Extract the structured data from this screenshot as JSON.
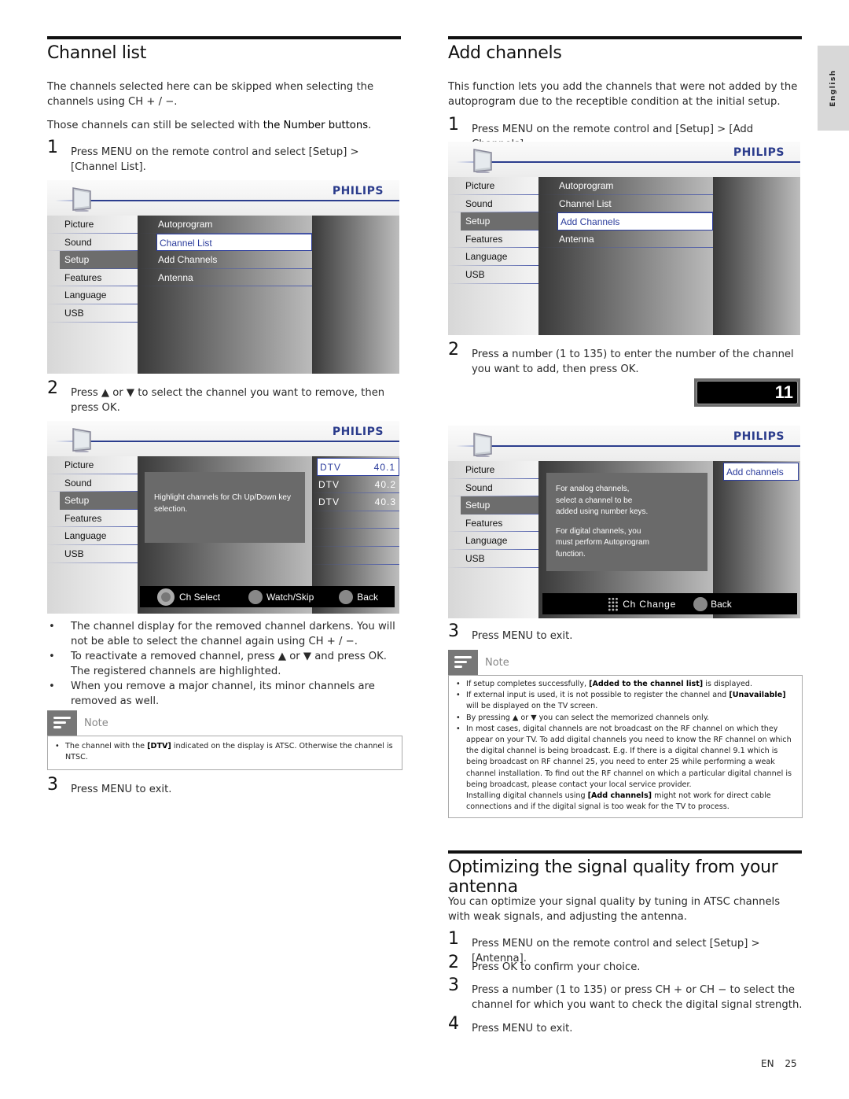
{
  "side_tab": "English",
  "footer": {
    "lang": "EN",
    "page": "25"
  },
  "channel_list": {
    "title": "Channel list",
    "intro1": "The channels selected here can be skipped when selecting the channels using CH + / −.",
    "intro2_pre": "Those channels can still be selected with ",
    "intro2_bold": "the Number buttons",
    "intro2_post": ".",
    "steps": [
      {
        "num": "1",
        "text": "Press MENU on the remote control and select [Setup] > [Channel List]."
      },
      {
        "num": "2",
        "text": "Press ▲ or ▼ to select the channel you want to remove, then press OK."
      },
      {
        "num": "3",
        "text": "Press MENU to exit."
      }
    ],
    "bullets": [
      "The channel display for the removed channel darkens. You will not be able to select the channel again using CH + / −.",
      "To reactivate a removed channel, press ▲ or ▼ and press OK. The registered channels are highlighted.",
      "When you remove a major channel, its minor channels are removed as well."
    ],
    "note": {
      "label": "Note",
      "items": [
        {
          "pre": "The channel with the ",
          "bold": "[DTV]",
          "post": " indicated on the display is ATSC. Otherwise the channel is NTSC."
        }
      ]
    }
  },
  "tv_menu": {
    "brand": "PHILIPS",
    "left_items": [
      "Picture",
      "Sound",
      "Setup",
      "Features",
      "Language",
      "USB"
    ],
    "selected_left": "Setup",
    "setup_items": [
      "Autoprogram",
      "Channel List",
      "Add Channels",
      "Antenna"
    ]
  },
  "tv_channel_list": {
    "info": "Highlight channels for Ch Up/Down key selection.",
    "channels": [
      {
        "type": "DTV",
        "num": "40.1",
        "selected": true
      },
      {
        "type": "DTV",
        "num": "40.2",
        "selected": false
      },
      {
        "type": "DTV",
        "num": "40.3",
        "selected": false
      }
    ],
    "buttons": {
      "ch_select": "Ch Select",
      "ok_small": "OK",
      "watch_skip": "Watch/Skip",
      "back_small": "BACK",
      "back": "Back"
    }
  },
  "add_channels": {
    "title": "Add channels",
    "intro": "This function lets you add the channels that were not added by the autoprogram due to the receptible condition at the initial setup.",
    "steps": [
      {
        "num": "1",
        "text": "Press MENU on the remote control and [Setup] > [Add Channels]."
      },
      {
        "num": "2",
        "text": "Press a number (1 to 135) to enter the number of the channel you want to add, then press OK."
      },
      {
        "num": "3",
        "text": "Press MENU to exit."
      }
    ],
    "channel_entry": "11",
    "tv_screen": {
      "option": "Add channels",
      "info_analog": "For analog channels, select a channel to be added using number keys.",
      "info_digital": "For digital channels, you must perform Autoprogram function.",
      "buttons": {
        "ch_change": "Ch Change",
        "back_small": "BACK",
        "back": "Back"
      }
    },
    "note": {
      "label": "Note",
      "items": [
        {
          "pre": "If setup completes successfully, ",
          "bold": "[Added to the channel list]",
          "post": " is displayed."
        },
        {
          "pre": "If external input is used, it is not possible to register the channel and ",
          "bold": "[Unavailable]",
          "post": " will be displayed on the TV screen."
        },
        {
          "pre": "By pressing ▲ or ▼ you can select the memorized channels only.",
          "bold": "",
          "post": ""
        },
        {
          "pre": "In most cases, digital channels are not broadcast on the RF channel on which they appear on your TV. To add digital channels you need to know the RF channel on which the digital channel is being broadcast. E.g. If there is a digital channel 9.1 which is being broadcast on RF channel 25, you need to enter 25 while performing a weak channel installation. To find out the RF channel on which a particular digital channel is being broadcast, please contact your local service provider.",
          "bold": "",
          "post": ""
        }
      ],
      "extra_pre": "Installing digital channels using ",
      "extra_bold": "[Add channels]",
      "extra_post": " might not work for direct cable connections and if the digital signal is too weak for the TV to process."
    }
  },
  "optimize": {
    "title": "Optimizing the signal quality from your antenna",
    "intro": "You can optimize your signal quality by tuning in ATSC channels with weak signals, and adjusting the antenna.",
    "steps": [
      {
        "num": "1",
        "text": "Press MENU on the remote control and select [Setup] > [Antenna]."
      },
      {
        "num": "2",
        "text": "Press OK to confirm your choice."
      },
      {
        "num": "3",
        "text": "Press a number (1 to 135) or press CH + or CH − to select the channel for which you want to check the digital signal strength."
      },
      {
        "num": "4",
        "text": "Press MENU to exit."
      }
    ]
  }
}
